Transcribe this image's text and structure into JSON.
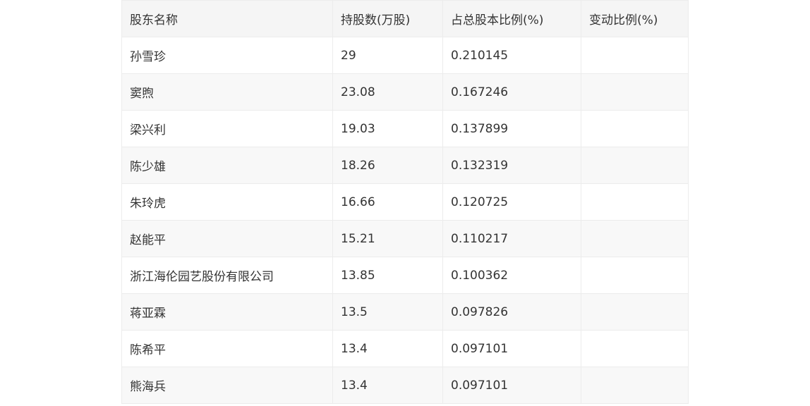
{
  "table": {
    "headers": [
      "股东名称",
      "持股数(万股)",
      "占总股本比例(%)",
      "变动比例(%)"
    ],
    "rows": [
      {
        "name": "孙雪珍",
        "shares": "29",
        "ratio": "0.210145",
        "change": ""
      },
      {
        "name": "窦煦",
        "shares": "23.08",
        "ratio": "0.167246",
        "change": ""
      },
      {
        "name": "梁兴利",
        "shares": "19.03",
        "ratio": "0.137899",
        "change": ""
      },
      {
        "name": "陈少雄",
        "shares": "18.26",
        "ratio": "0.132319",
        "change": ""
      },
      {
        "name": "朱玲虎",
        "shares": "16.66",
        "ratio": "0.120725",
        "change": ""
      },
      {
        "name": "赵能平",
        "shares": "15.21",
        "ratio": "0.110217",
        "change": ""
      },
      {
        "name": "浙江海伦园艺股份有限公司",
        "shares": "13.85",
        "ratio": "0.100362",
        "change": ""
      },
      {
        "name": "蒋亚霖",
        "shares": "13.5",
        "ratio": "0.097826",
        "change": ""
      },
      {
        "name": "陈希平",
        "shares": "13.4",
        "ratio": "0.097101",
        "change": ""
      },
      {
        "name": "熊海兵",
        "shares": "13.4",
        "ratio": "0.097101",
        "change": ""
      }
    ]
  }
}
